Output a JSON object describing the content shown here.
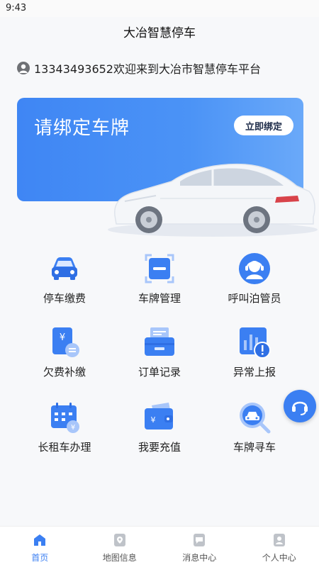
{
  "status_bar": {
    "time": "9:43"
  },
  "header": {
    "title": "大冶智慧停车"
  },
  "welcome": {
    "text": "13343493652欢迎来到大冶市智慧停车平台"
  },
  "banner": {
    "title": "请绑定车牌",
    "button_label": "立即绑定"
  },
  "grid": {
    "items": [
      {
        "label": "停车缴费",
        "icon": "car-front-icon"
      },
      {
        "label": "车牌管理",
        "icon": "plate-scan-icon"
      },
      {
        "label": "呼叫泊管员",
        "icon": "headset-agent-icon"
      },
      {
        "label": "欠费补缴",
        "icon": "bill-yen-icon"
      },
      {
        "label": "订单记录",
        "icon": "order-printer-icon"
      },
      {
        "label": "异常上报",
        "icon": "alert-chart-icon"
      },
      {
        "label": "长租车办理",
        "icon": "calendar-yen-icon"
      },
      {
        "label": "我要充值",
        "icon": "wallet-yen-icon"
      },
      {
        "label": "车牌寻车",
        "icon": "search-car-icon"
      }
    ]
  },
  "tabbar": {
    "tabs": [
      {
        "label": "首页",
        "icon": "home-icon",
        "active": true
      },
      {
        "label": "地图信息",
        "icon": "map-pin-icon",
        "active": false
      },
      {
        "label": "消息中心",
        "icon": "message-icon",
        "active": false
      },
      {
        "label": "个人中心",
        "icon": "person-icon",
        "active": false
      }
    ]
  },
  "colors": {
    "accent": "#3b7ff2",
    "banner": "#4b93f6",
    "text": "#222222"
  }
}
